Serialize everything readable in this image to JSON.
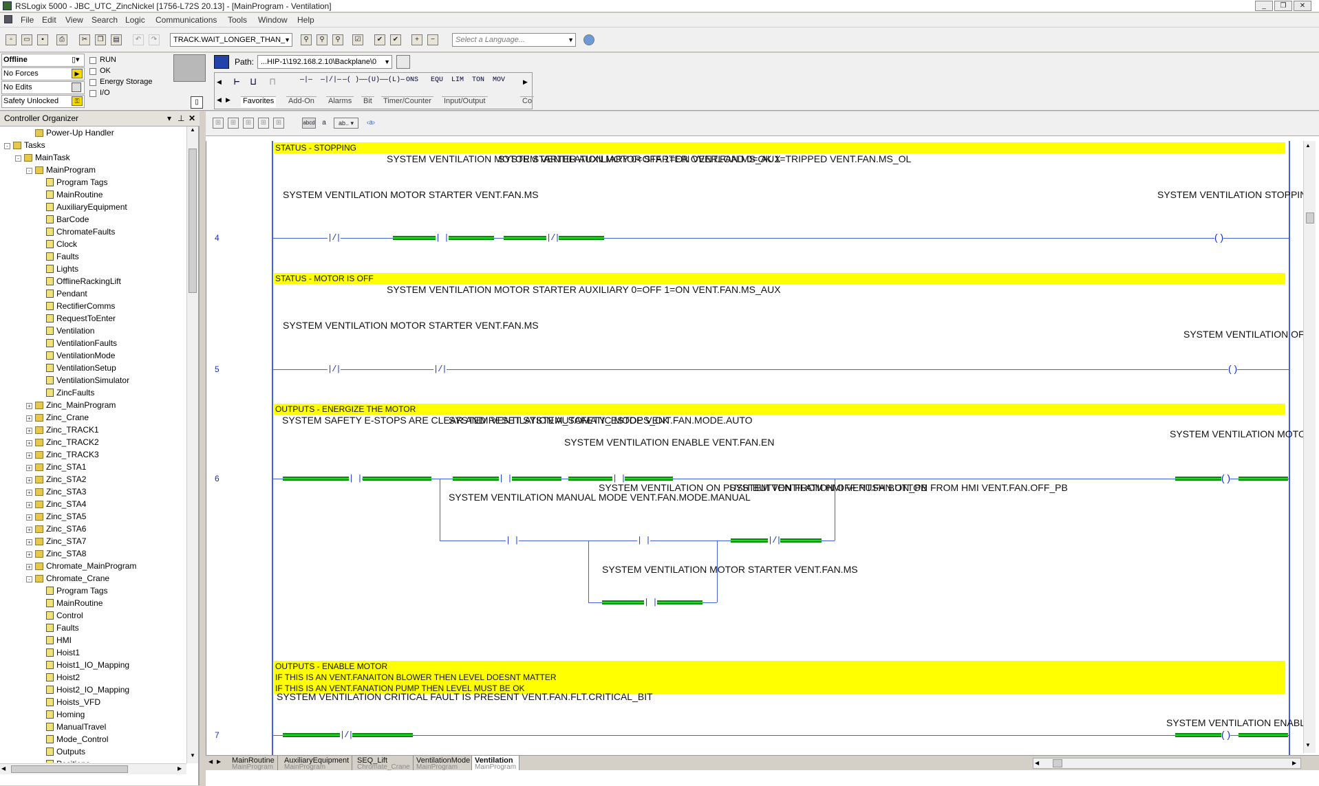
{
  "window": {
    "title": "RSLogix 5000 - JBC_UTC_ZincNickel [1756-L72S 20.13] - [MainProgram - Ventilation]"
  },
  "menu": [
    "File",
    "Edit",
    "View",
    "Search",
    "Logic",
    "Communications",
    "Tools",
    "Window",
    "Help"
  ],
  "toolbar": {
    "tag_combo": "TRACK.WAIT_LONGER_THAN_",
    "language_placeholder": "Select a Language..."
  },
  "status": {
    "mode": "Offline",
    "forces": "No Forces",
    "edits": "No Edits",
    "safety": "Safety Unlocked",
    "indicators": [
      "RUN",
      "OK",
      "Energy Storage",
      "I/O"
    ]
  },
  "path": {
    "label": "Path:",
    "value": "...HIP-1\\192.168.2.10\\Backplane\\0"
  },
  "instructions": [
    "—|—",
    "—|/|—",
    "—( )—",
    "—(U)—",
    "—(L)—",
    "ONS",
    "EQU",
    "LIM",
    "TON",
    "MOV"
  ],
  "instruction_tabs": [
    "Favorites",
    "Add-On",
    "Alarms",
    "Bit",
    "Timer/Counter",
    "Input/Output",
    "Co"
  ],
  "organizer": {
    "title": "Controller Organizer",
    "items": [
      {
        "label": "Power-Up Handler",
        "indent": 2,
        "icon": "folder"
      },
      {
        "label": "Tasks",
        "indent": 0,
        "icon": "folder",
        "exp": "-"
      },
      {
        "label": "MainTask",
        "indent": 1,
        "icon": "folder",
        "exp": "-"
      },
      {
        "label": "MainProgram",
        "indent": 2,
        "icon": "folder",
        "exp": "-"
      },
      {
        "label": "Program Tags",
        "indent": 3,
        "icon": "routine"
      },
      {
        "label": "MainRoutine",
        "indent": 3,
        "icon": "routine"
      },
      {
        "label": "AuxiliaryEquipment",
        "indent": 3,
        "icon": "routine"
      },
      {
        "label": "BarCode",
        "indent": 3,
        "icon": "routine"
      },
      {
        "label": "ChromateFaults",
        "indent": 3,
        "icon": "routine"
      },
      {
        "label": "Clock",
        "indent": 3,
        "icon": "routine"
      },
      {
        "label": "Faults",
        "indent": 3,
        "icon": "routine"
      },
      {
        "label": "Lights",
        "indent": 3,
        "icon": "routine"
      },
      {
        "label": "OfflineRackingLift",
        "indent": 3,
        "icon": "routine"
      },
      {
        "label": "Pendant",
        "indent": 3,
        "icon": "routine"
      },
      {
        "label": "RectifierComms",
        "indent": 3,
        "icon": "routine"
      },
      {
        "label": "RequestToEnter",
        "indent": 3,
        "icon": "routine"
      },
      {
        "label": "Ventilation",
        "indent": 3,
        "icon": "routine"
      },
      {
        "label": "VentilationFaults",
        "indent": 3,
        "icon": "routine"
      },
      {
        "label": "VentilationMode",
        "indent": 3,
        "icon": "routine"
      },
      {
        "label": "VentilationSetup",
        "indent": 3,
        "icon": "routine"
      },
      {
        "label": "VentilationSimulator",
        "indent": 3,
        "icon": "routine"
      },
      {
        "label": "ZincFaults",
        "indent": 3,
        "icon": "routine"
      },
      {
        "label": "Zinc_MainProgram",
        "indent": 2,
        "icon": "folder",
        "exp": "+"
      },
      {
        "label": "Zinc_Crane",
        "indent": 2,
        "icon": "folder",
        "exp": "+"
      },
      {
        "label": "Zinc_TRACK1",
        "indent": 2,
        "icon": "folder",
        "exp": "+"
      },
      {
        "label": "Zinc_TRACK2",
        "indent": 2,
        "icon": "folder",
        "exp": "+"
      },
      {
        "label": "Zinc_TRACK3",
        "indent": 2,
        "icon": "folder",
        "exp": "+"
      },
      {
        "label": "Zinc_STA1",
        "indent": 2,
        "icon": "folder",
        "exp": "+"
      },
      {
        "label": "Zinc_STA2",
        "indent": 2,
        "icon": "folder",
        "exp": "+"
      },
      {
        "label": "Zinc_STA3",
        "indent": 2,
        "icon": "folder",
        "exp": "+"
      },
      {
        "label": "Zinc_STA4",
        "indent": 2,
        "icon": "folder",
        "exp": "+"
      },
      {
        "label": "Zinc_STA5",
        "indent": 2,
        "icon": "folder",
        "exp": "+"
      },
      {
        "label": "Zinc_STA6",
        "indent": 2,
        "icon": "folder",
        "exp": "+"
      },
      {
        "label": "Zinc_STA7",
        "indent": 2,
        "icon": "folder",
        "exp": "+"
      },
      {
        "label": "Zinc_STA8",
        "indent": 2,
        "icon": "folder",
        "exp": "+"
      },
      {
        "label": "Chromate_MainProgram",
        "indent": 2,
        "icon": "folder",
        "exp": "+"
      },
      {
        "label": "Chromate_Crane",
        "indent": 2,
        "icon": "folder",
        "exp": "-"
      },
      {
        "label": "Program Tags",
        "indent": 3,
        "icon": "routine"
      },
      {
        "label": "MainRoutine",
        "indent": 3,
        "icon": "routine"
      },
      {
        "label": "Control",
        "indent": 3,
        "icon": "routine"
      },
      {
        "label": "Faults",
        "indent": 3,
        "icon": "routine"
      },
      {
        "label": "HMI",
        "indent": 3,
        "icon": "routine"
      },
      {
        "label": "Hoist1",
        "indent": 3,
        "icon": "routine"
      },
      {
        "label": "Hoist1_IO_Mapping",
        "indent": 3,
        "icon": "routine"
      },
      {
        "label": "Hoist2",
        "indent": 3,
        "icon": "routine"
      },
      {
        "label": "Hoist2_IO_Mapping",
        "indent": 3,
        "icon": "routine"
      },
      {
        "label": "Hoists_VFD",
        "indent": 3,
        "icon": "routine"
      },
      {
        "label": "Homing",
        "indent": 3,
        "icon": "routine"
      },
      {
        "label": "ManualTravel",
        "indent": 3,
        "icon": "routine"
      },
      {
        "label": "Mode_Control",
        "indent": 3,
        "icon": "routine"
      },
      {
        "label": "Outputs",
        "indent": 3,
        "icon": "routine"
      },
      {
        "label": "Positions",
        "indent": 3,
        "icon": "routine"
      }
    ]
  },
  "ladder": {
    "r4": {
      "num": "4",
      "comment": "STATUS - STOPPING",
      "a": "SYSTEM\nVENTILATION MOTOR\nSTARTER\nVENT.FAN.MS",
      "b": "SYSTEM\nVENTILATION MOTOR\nSTARTER\nAUXILIARY\n0=OFF\n1=ON\nVENT.FAN.MS_AUX",
      "c": "SYSTEM\nVENTILATION MOTOR\nSTARTER\nOVERLOAD\n0=OK\n1=TRIPPED\nVENT.FAN.MS_OL",
      "out": "SYSTEM\nVENTILATION STOPPING\nVENT.FAN.STOPPING"
    },
    "r5": {
      "num": "5",
      "comment": "STATUS - MOTOR IS OFF",
      "a": "SYSTEM\nVENTILATION MOTOR\nSTARTER\nVENT.FAN.MS",
      "b": "SYSTEM\nVENTILATION MOTOR\nSTARTER\nAUXILIARY\n0=OFF\n1=ON\nVENT.FAN.MS_AUX",
      "out": "SYSTEM\nVENTILATION OFF\nVENT.FAN.OFF"
    },
    "r6": {
      "num": "6",
      "comment": "OUTPUTS - ENERGIZE THE MOTOR",
      "a": "SYSTEM\nSAFETY\nE-STOPS ARE\nCLEAR AND RESET\nSYSTEM_SAFETY_ESTOPS_OK",
      "b": "SYSTEM\nVENTILATION\nAUTOMATIC\nMODE\nVENT.FAN.MODE.AUTO",
      "c": "SYSTEM\nVENTILATION ENABLE\nVENT.FAN.EN",
      "d": "SYSTEM\nVENTILATION MANUAL\nMODE\nVENT.FAN.MODE.MANUAL",
      "e": "SYSTEM\nVENTILATION ON\nPUSH BUTTON\nFROM HMI\nVENT.FAN.ON_PB",
      "f": "SYSTEM\nVENTILATION OFF\nPUSH BUTTON\nFROM HMI\nVENT.FAN.OFF_PB",
      "g": "SYSTEM\nVENTILATION MOTOR\nSTARTER\nVENT.FAN.MS",
      "out": "SYSTEM\nVENTILATION MOTOR\nSTARTER\nVENT.FAN.MS"
    },
    "r7": {
      "num": "7",
      "comment": "OUTPUTS - ENABLE MOTOR\nIF THIS IS AN VENT.FANAITON BLOWER THEN LEVEL DOESNT MATTER\nIF THIS IS AN VENT.FANATION PUMP THEN LEVEL MUST BE OK",
      "a": "SYSTEM\nVENTILATION CRITICAL\nFAULT\nIS PRESENT\nVENT.FAN.FLT.CRITICAL_BIT",
      "out": "SYSTEM\nVENTILATION ENABLE\nVENT.FAN.EN"
    }
  },
  "routine_tabs": [
    {
      "name": "MainRoutine",
      "program": "MainProgram"
    },
    {
      "name": "AuxiliaryEquipment",
      "program": "MainProgram"
    },
    {
      "name": "SEQ_Lift",
      "program": "Chromate_Crane"
    },
    {
      "name": "VentilationMode",
      "program": "MainProgram"
    },
    {
      "name": "Ventilation",
      "program": "MainProgram"
    }
  ],
  "colors": {
    "rung_wire": "#4060e0",
    "energized": "#22d822",
    "comment_bg": "#ffff00"
  }
}
